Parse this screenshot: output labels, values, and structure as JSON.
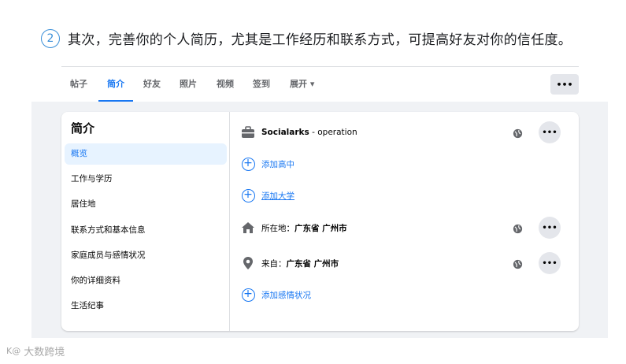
{
  "step": {
    "number": "2",
    "text": "其次，完善你的个人简历，尤其是工作经历和联系方式，可提高好友对你的信任度。"
  },
  "tabs": [
    {
      "label": "帖子"
    },
    {
      "label": "简介",
      "active": true
    },
    {
      "label": "好友"
    },
    {
      "label": "照片"
    },
    {
      "label": "视频"
    },
    {
      "label": "签到"
    },
    {
      "label": "展开 ▾"
    }
  ],
  "more_button": "•••",
  "sidebar": {
    "title": "简介",
    "items": [
      {
        "label": "概览",
        "active": true
      },
      {
        "label": "工作与学历"
      },
      {
        "label": "居住地"
      },
      {
        "label": "联系方式和基本信息"
      },
      {
        "label": "家庭成员与感情状况"
      },
      {
        "label": "你的详细资料"
      },
      {
        "label": "生活纪事"
      }
    ]
  },
  "overview": {
    "work": {
      "company": "Socialarks",
      "role": " - operation",
      "icon": "briefcase-icon"
    },
    "add_highschool": "添加高中",
    "add_college": "添加大学",
    "current_city": {
      "prefix": "所在地：",
      "value": "广东省 广州市",
      "icon": "home-icon"
    },
    "hometown": {
      "prefix": "来自：",
      "value": "广东省 广州市",
      "icon": "location-pin-icon"
    },
    "add_relationship": "添加感情状况",
    "dots": "•••"
  },
  "watermark": {
    "logo": "K@",
    "text": "大数跨境"
  },
  "colors": {
    "accent": "#1877f2",
    "step_blue": "#3a8fd8",
    "page_gray": "#f0f2f5"
  }
}
